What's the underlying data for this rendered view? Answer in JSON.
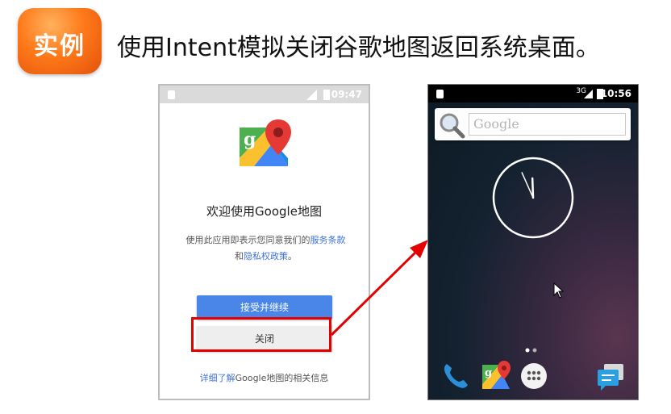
{
  "header": {
    "badge": "实例",
    "title": "使用Intent模拟关闭谷歌地图返回系统桌面。"
  },
  "left_phone": {
    "status_time": "09:47",
    "welcome": "欢迎使用Google地图",
    "terms_prefix": "使用此应用即表示您同意我们的",
    "terms_link": "服务条款",
    "terms_and": "和",
    "privacy_link": "隐私权政策",
    "terms_suffix": "。",
    "accept_button": "接受并继续",
    "close_button": "关闭",
    "more_info_link": "详细了解",
    "more_info_text": "Google地图的相关信息"
  },
  "right_phone": {
    "status_time": "10:56",
    "network": "3G",
    "search_placeholder": "Google",
    "clock": {
      "hour": 11,
      "minute": 56
    },
    "dock_icons": [
      "phone-icon",
      "maps-icon",
      "app-drawer-icon",
      "messaging-icon"
    ]
  },
  "colors": {
    "badge_orange": "#ff7a1a",
    "highlight_red": "#e50000",
    "accept_blue": "#4a86e8",
    "link_blue": "#3f72d8"
  }
}
